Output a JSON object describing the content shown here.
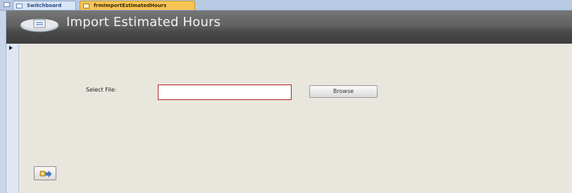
{
  "tabs": [
    {
      "label": "Switchboard",
      "active": false
    },
    {
      "label": "frmImportEstimatedHours",
      "active": true
    }
  ],
  "header": {
    "title": "Import Estimated Hours",
    "logo_icon": "form-logo-icon"
  },
  "record_selector": {
    "icon": "current-record-arrow-icon"
  },
  "form": {
    "select_file_label": "Select File:",
    "file_input_value": "",
    "browse_label": "Browse",
    "run_button_icon": "run-import-icon"
  },
  "colors": {
    "header_dark": "#4a4a4a",
    "form_background": "#e9e6de",
    "active_tab": "#f7c453",
    "input_border": "#b22222"
  }
}
